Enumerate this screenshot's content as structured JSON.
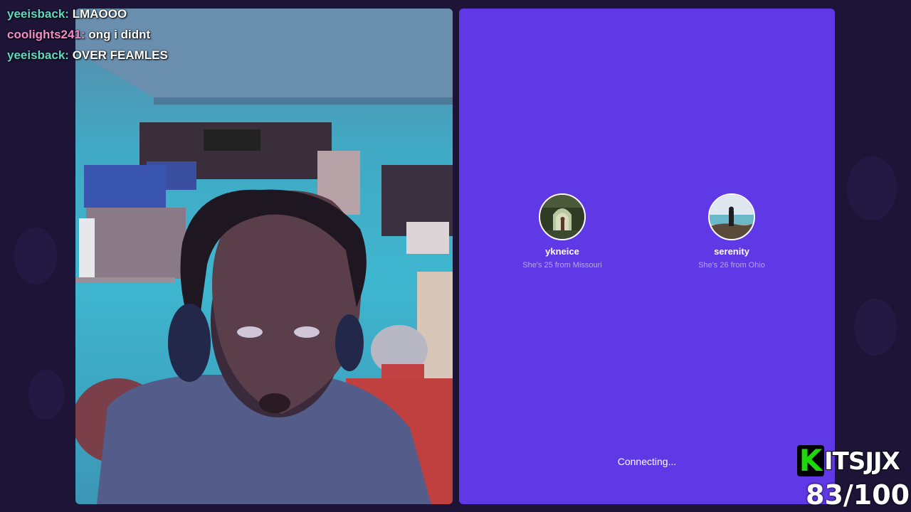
{
  "chat": [
    {
      "user": "yeeisback",
      "sep": ":",
      "message": "LMAOOO",
      "color": "#5ed9c3"
    },
    {
      "user": "coolights241",
      "sep": ":",
      "message": "ong i didnt",
      "color": "#f08cc8"
    },
    {
      "user": "yeeisback",
      "sep": ":",
      "message": "OVER FEAMLES",
      "color": "#5ed9c3"
    }
  ],
  "app": {
    "background": "#6039e6",
    "profiles": [
      {
        "name": "ykneice",
        "description": "She's 25 from Missouri"
      },
      {
        "name": "serenity",
        "description": "She's 26 from Ohio"
      }
    ],
    "status": "Connecting..."
  },
  "brand": {
    "logo_letter": "K",
    "name": "ITSJJX",
    "accent": "#1ed80a"
  },
  "counter": "83/100"
}
